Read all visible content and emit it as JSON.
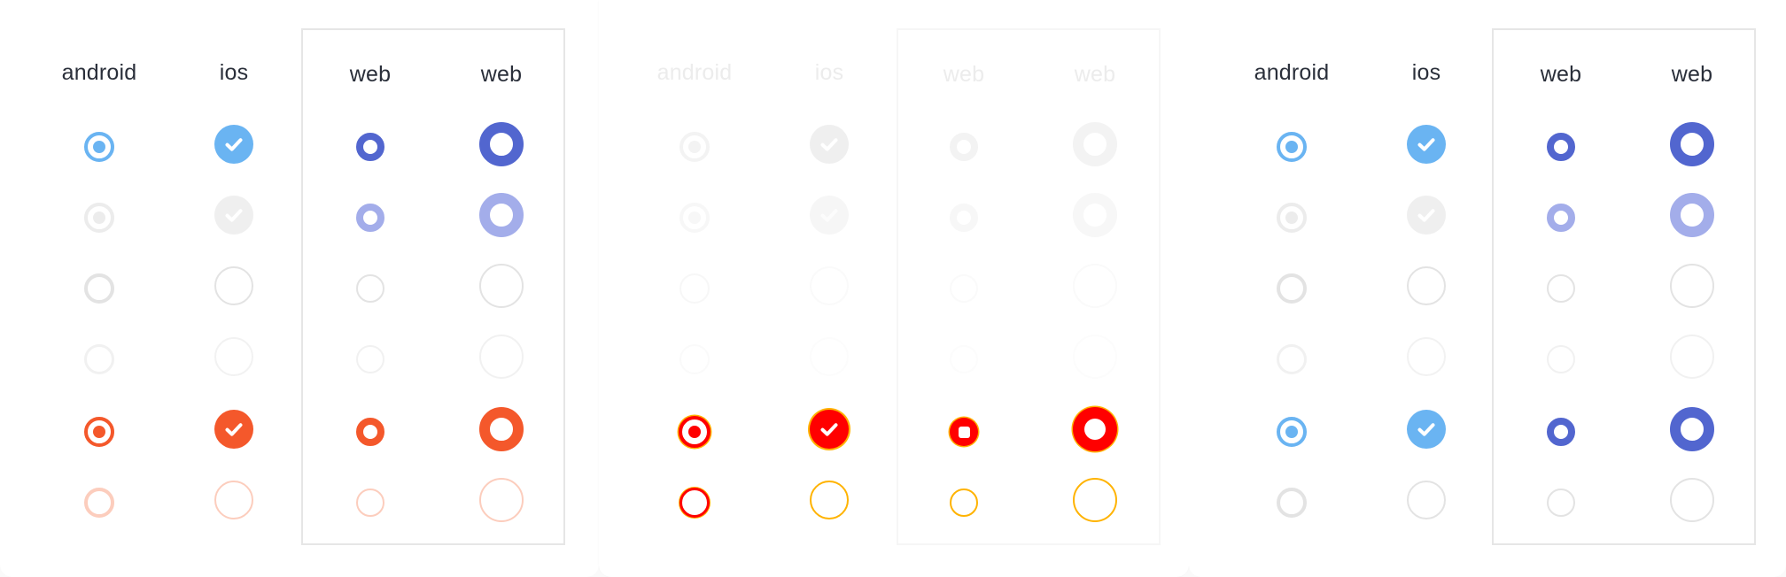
{
  "panels": [
    {
      "name": "panel-normal",
      "headers": [
        "android",
        "ios",
        "web",
        "web"
      ]
    },
    {
      "name": "panel-high-contrast",
      "headers": [
        "android",
        "ios",
        "web",
        "web"
      ]
    },
    {
      "name": "panel-theme-blue",
      "headers": [
        "android",
        "ios",
        "web",
        "web"
      ]
    }
  ],
  "colors": {
    "android_blue": "#6ab4f2",
    "web_blue": "#5266cf",
    "web_blue_disabled": "#a3adea",
    "orange": "#f4582b",
    "orange_disabled": "#fccdbd",
    "disabled_grey": "#ececec",
    "empty_grey": "#e3e3e3",
    "hc_red": "#ff0000",
    "hc_yellow_outline": "#ffb300",
    "border": "#e6e6e6"
  },
  "row_states": [
    "checked",
    "checked-disabled",
    "unchecked",
    "unchecked-disabled",
    "checked-invalid",
    "unchecked-invalid"
  ]
}
